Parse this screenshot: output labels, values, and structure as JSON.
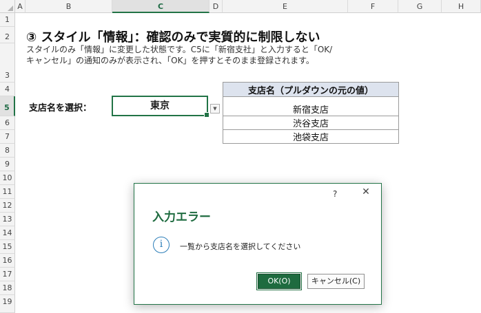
{
  "columns": [
    "A",
    "B",
    "C",
    "D",
    "E",
    "F",
    "G",
    "H"
  ],
  "rows": [
    "1",
    "2",
    "3",
    "4",
    "5",
    "6",
    "7",
    "8",
    "9",
    "10",
    "11",
    "12",
    "13",
    "14",
    "15",
    "16",
    "17",
    "18",
    "19"
  ],
  "sheet": {
    "title": "③ スタイル「情報」：確認のみで実質的に制限しない",
    "description_line1": "スタイルのみ「情報」に変更した状態です。C5に「新宿支社」と入力すると「OK/",
    "description_line2": "キャンセル」の通知のみが表示され、「OK」を押すとそのまま登録されます。",
    "select_label": "支店名を選択：",
    "c5_value": "東京",
    "dropdown_arrow": "▼",
    "source_table": {
      "header": "支店名（プルダウンの元の値）",
      "items": [
        "新宿支店",
        "渋谷支店",
        "池袋支店"
      ]
    }
  },
  "dialog": {
    "help": "?",
    "close": "✕",
    "title": "入力エラー",
    "icon": "i",
    "message": "一覧から支店名を選択してください",
    "ok_label": "OK(O)",
    "cancel_label": "キャンセル(C)"
  },
  "colors": {
    "accent": "#217346",
    "dialog_title": "#1e6b3f",
    "info_icon": "#2b7db8"
  }
}
